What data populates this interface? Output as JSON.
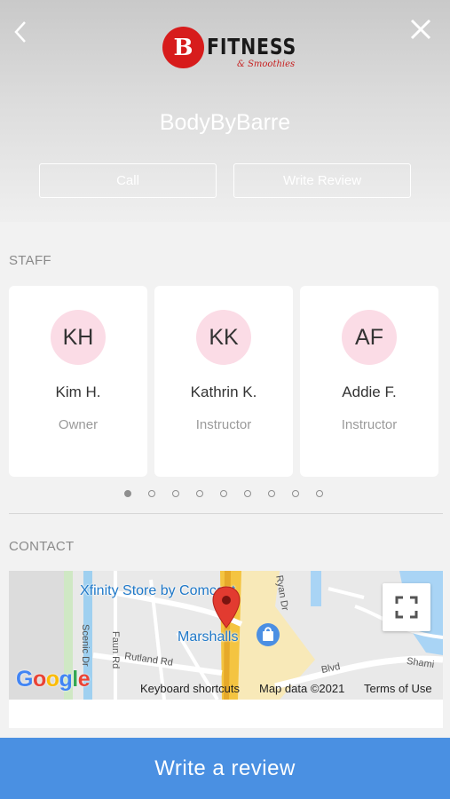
{
  "header": {
    "logo": {
      "letter": "B",
      "title": "FITNESS",
      "subtitle": "& Smoothies"
    },
    "studio_name": "BodyByBarre",
    "call_label": "Call",
    "write_review_label": "Write Review"
  },
  "staff": {
    "label": "STAFF",
    "members": [
      {
        "initials": "KH",
        "name": "Kim H.",
        "role": "Owner"
      },
      {
        "initials": "KK",
        "name": "Kathrin K.",
        "role": "Instructor"
      },
      {
        "initials": "AF",
        "name": "Addie F.",
        "role": "Instructor"
      }
    ],
    "page_count": 9,
    "active_page": 1
  },
  "contact": {
    "label": "CONTACT",
    "map": {
      "place_labels": [
        "Xfinity Store by Comcast",
        "Marshalls"
      ],
      "streets": [
        "Scenic Dr",
        "Faun Rd",
        "Rutland Rd",
        "Blvd",
        "Shami",
        "Ryan Dr"
      ],
      "google_text": "Google",
      "keyboard_shortcuts": "Keyboard shortcuts",
      "map_data": "Map data ©2021",
      "terms": "Terms of Use"
    }
  },
  "footer": {
    "write_review_button": "Write a review"
  },
  "colors": {
    "accent_blue": "#4a90e2",
    "logo_red": "#d71c1c",
    "avatar_pink": "#fbdce6",
    "map_pin_red": "#e23b30"
  }
}
